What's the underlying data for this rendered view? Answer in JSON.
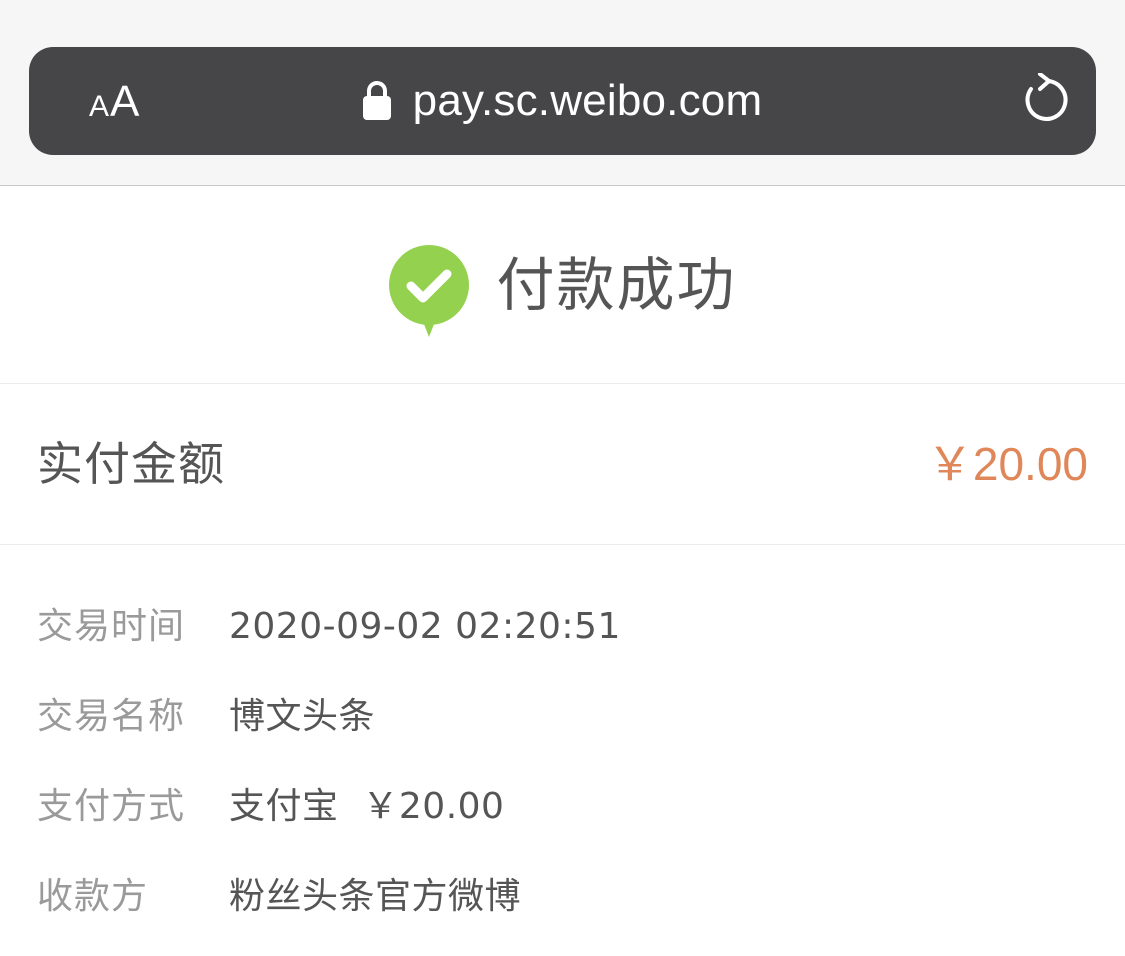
{
  "browser": {
    "text_size_button_small": "A",
    "text_size_button_large": "A",
    "url": "pay.sc.weibo.com",
    "lock_icon": "lock-icon",
    "reload_icon": "reload-icon",
    "bar_color": "#464648"
  },
  "payment": {
    "status_icon": "check-circle-icon",
    "status_color": "#94d14f",
    "status_text": "付款成功",
    "amount_label": "实付金额",
    "amount_value": "￥20.00",
    "amount_color": "#e0875a"
  },
  "details": [
    {
      "label": "交易时间",
      "value": "2020-09-02 02:20:51"
    },
    {
      "label": "交易名称",
      "value": "博文头条"
    },
    {
      "label": "支付方式",
      "value": "支付宝  ￥20.00"
    },
    {
      "label": "收款方",
      "value": "粉丝头条官方微博"
    }
  ]
}
